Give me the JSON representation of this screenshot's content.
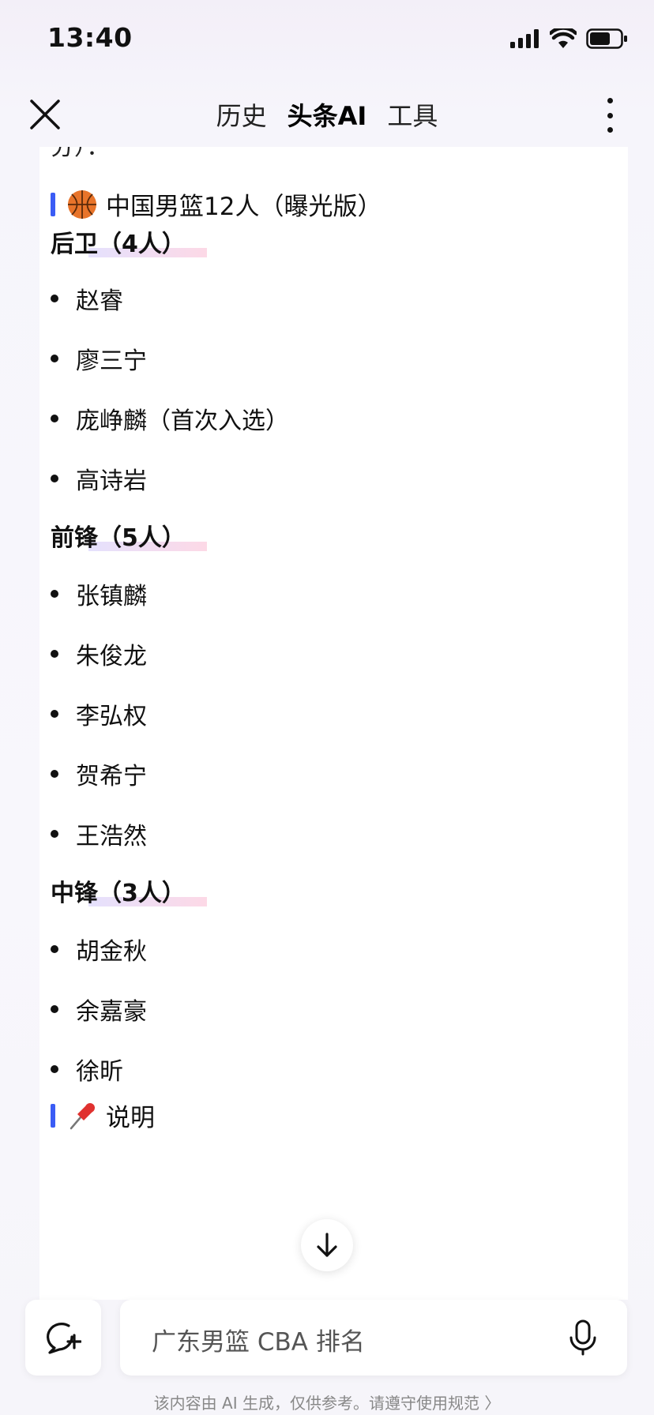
{
  "status_bar": {
    "time": "13:40",
    "icons": [
      "signal-icon",
      "wifi-icon",
      "battery-icon"
    ]
  },
  "nav": {
    "tabs": [
      {
        "label": "历史"
      },
      {
        "label": "头条AI"
      },
      {
        "label": "工具"
      }
    ],
    "active_tab": "头条AI"
  },
  "content": {
    "cut_text": "分）：",
    "heading": "中国男篮12人（曝光版）",
    "groups": [
      {
        "title": "后卫（4人）",
        "players": [
          "赵睿",
          "廖三宁",
          "庞峥麟（首次入选）",
          "高诗岩"
        ]
      },
      {
        "title": "前锋（5人）",
        "players": [
          "张镇麟",
          "朱俊龙",
          "李弘权",
          "贺希宁",
          "王浩然"
        ]
      },
      {
        "title": "中锋（3人）",
        "players": [
          "胡金秋",
          "余嘉豪",
          "徐昕"
        ]
      }
    ],
    "note_heading": "说明"
  },
  "input": {
    "placeholder": "广东男篮 CBA 排名"
  },
  "disclaimer": "该内容由 AI 生成，仅供参考。请遵守使用规范 〉",
  "colors": {
    "accent_bar": "#3a5cf5",
    "background": "#f6f5fa"
  }
}
